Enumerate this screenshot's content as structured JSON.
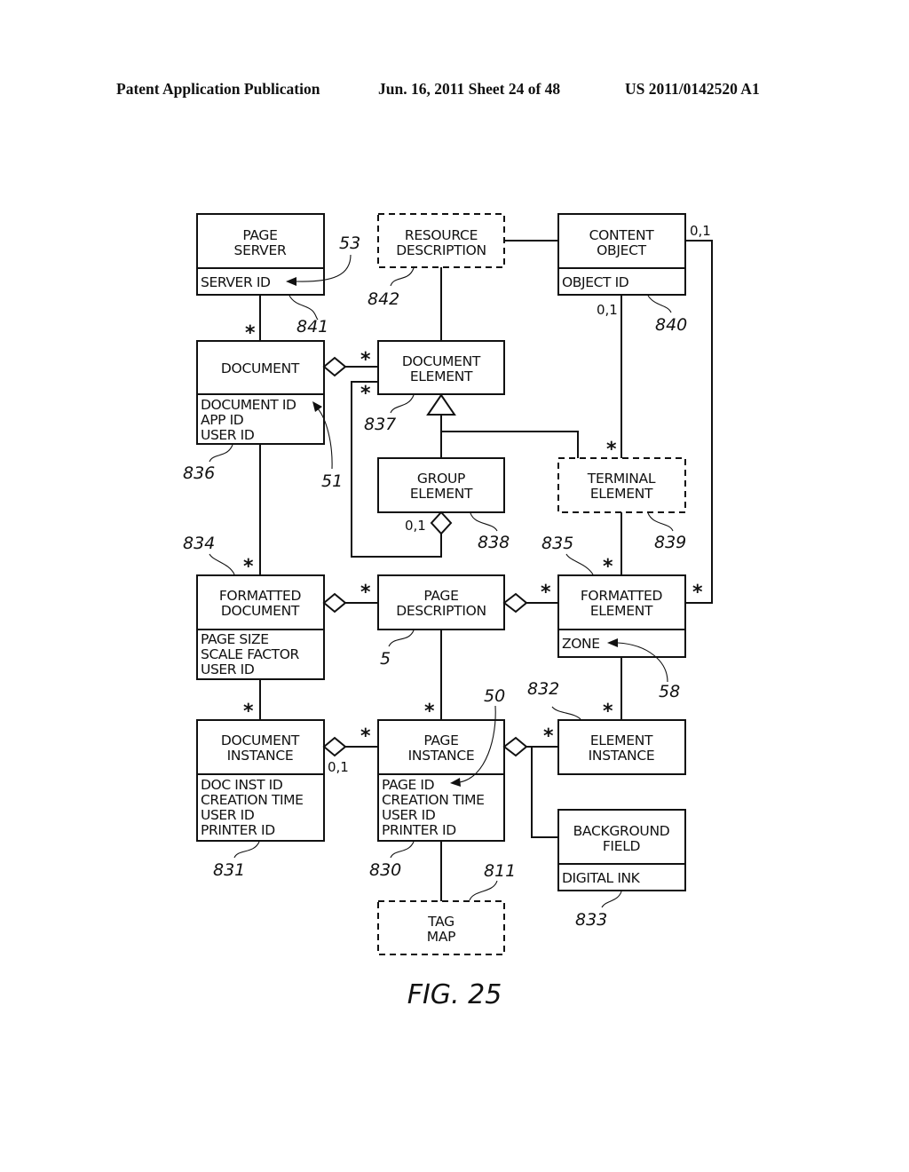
{
  "header": {
    "publication": "Patent Application Publication",
    "date_sheet": "Jun. 16, 2011  Sheet 24 of 48",
    "patent_number": "US 2011/0142520 A1"
  },
  "figure_caption": "FIG. 25",
  "entities": {
    "page_server": {
      "title": [
        "PAGE",
        "SERVER"
      ],
      "attributes": [
        "SERVER ID"
      ],
      "ref": "841",
      "dashed": false
    },
    "resource_description": {
      "title": [
        "RESOURCE",
        "DESCRIPTION"
      ],
      "attributes": [],
      "ref": "842",
      "dashed": true
    },
    "content_object": {
      "title": [
        "CONTENT",
        "OBJECT"
      ],
      "attributes": [
        "OBJECT ID"
      ],
      "ref": "840",
      "dashed": false
    },
    "document": {
      "title": [
        "DOCUMENT"
      ],
      "attributes": [
        "DOCUMENT ID",
        "APP ID",
        "USER ID"
      ],
      "ref": "836",
      "dashed": false
    },
    "document_element": {
      "title": [
        "DOCUMENT",
        "ELEMENT"
      ],
      "attributes": [],
      "ref": "837",
      "dashed": false
    },
    "group_element": {
      "title": [
        "GROUP",
        "ELEMENT"
      ],
      "attributes": [],
      "ref": "838",
      "dashed": false
    },
    "terminal_element": {
      "title": [
        "TERMINAL",
        "ELEMENT"
      ],
      "attributes": [],
      "ref": "839",
      "dashed": true
    },
    "formatted_document": {
      "title": [
        "FORMATTED",
        "DOCUMENT"
      ],
      "attributes": [
        "PAGE SIZE",
        "SCALE FACTOR",
        "USER ID"
      ],
      "ref": "834",
      "dashed": false
    },
    "page_description": {
      "title": [
        "PAGE",
        "DESCRIPTION"
      ],
      "attributes": [],
      "ref": "5",
      "dashed": false
    },
    "formatted_element": {
      "title": [
        "FORMATTED",
        "ELEMENT"
      ],
      "attributes": [
        "ZONE"
      ],
      "ref": "835",
      "dashed": false
    },
    "document_instance": {
      "title": [
        "DOCUMENT",
        "INSTANCE"
      ],
      "attributes": [
        "DOC INST ID",
        "CREATION TIME",
        "USER ID",
        "PRINTER ID"
      ],
      "ref": "831",
      "dashed": false
    },
    "page_instance": {
      "title": [
        "PAGE",
        "INSTANCE"
      ],
      "attributes": [
        "PAGE ID",
        "CREATION TIME",
        "USER ID",
        "PRINTER ID"
      ],
      "ref": "830",
      "dashed": false
    },
    "element_instance": {
      "title": [
        "ELEMENT",
        "INSTANCE"
      ],
      "attributes": [],
      "ref": "832",
      "dashed": false
    },
    "background_field": {
      "title": [
        "BACKGROUND",
        "FIELD"
      ],
      "attributes": [
        "DIGITAL INK"
      ],
      "ref": "833",
      "dashed": false
    },
    "tag_map": {
      "title": [
        "TAG",
        "MAP"
      ],
      "attributes": [],
      "ref": "811",
      "dashed": true
    }
  },
  "multiplicities": {
    "many": "*",
    "zero_or_one": "0,1"
  },
  "pointer_refs": {
    "server_id": "53",
    "document_id": "51",
    "zone": "58",
    "page_id": "50"
  }
}
